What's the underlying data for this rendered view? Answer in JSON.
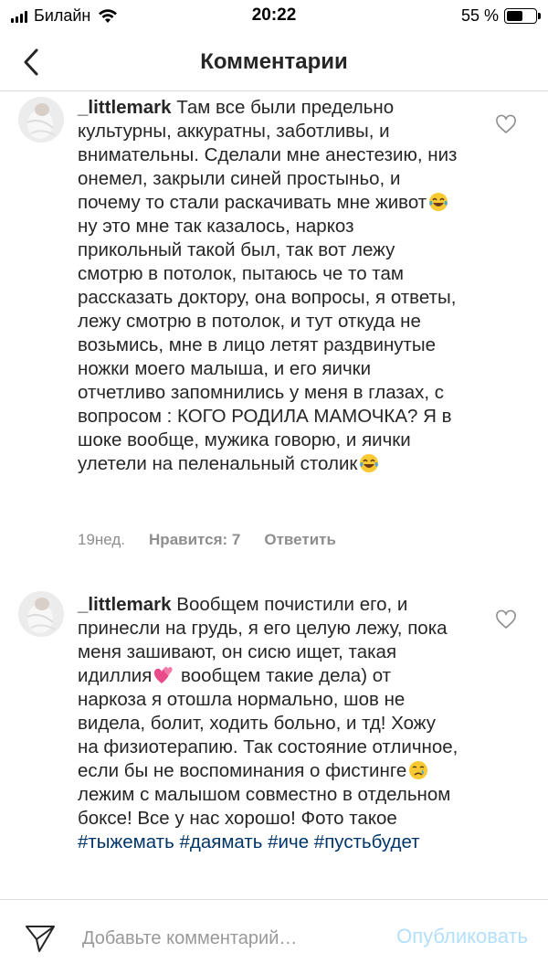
{
  "status_bar": {
    "carrier": "Билайн",
    "time": "20:22",
    "battery": "55 %",
    "battery_level": 0.55
  },
  "nav": {
    "title": "Комментарии"
  },
  "comments": [
    {
      "username": "_littlemark",
      "text_parts": [
        "Там все были предельно культурны, аккуратны, заботливы, и внимательны. Сделали мне анестезию, низ онемел, закрыли синей простыньо, и почему то стали раскачивать мне живот",
        " ну это мне так казалось, наркоз прикольный такой был, так вот лежу смотрю в потолок, пытаюсь че то там рассказать доктору, она вопросы, я ответы, лежу смотрю в потолок, и тут откуда не возьмись, мне в лицо летят раздвинутые ножки моего малыша, и его яички отчетливо запомнились у меня в глазах, с вопросом : КОГО РОДИЛА МАМОЧКА? Я в шоке вообще, мужика говорю, и яички улетели на пеленальный столик"
      ],
      "emojis": [
        "tears-of-joy-emoji",
        "tears-of-joy-emoji"
      ],
      "time": "19нед.",
      "likes": "Нравится: 7",
      "reply": "Ответить"
    },
    {
      "username": "_littlemark",
      "text_parts": [
        "Вообщем почистили его, и принесли на грудь, я его целую лежу, пока меня зашивают, он сисю ищет, такая идиллия",
        " вообщем такие дела) от наркоза я отошла нормально, шов не видела, болит, ходить больно, и тд! Хожу  на физиотерапию. Так состояние отличное, если бы не воспоминания о фистинге",
        "  лежим с малышом совместно в отдельном боксе! Все у нас хорошо!  Фото такое"
      ],
      "emojis": [
        "two-hearts-emoji",
        "crying-face-emoji"
      ],
      "hashtags": [
        "#тыжемать",
        "#даямать",
        "#иче",
        "#пустьбудет"
      ]
    }
  ],
  "footer": {
    "placeholder": "Добавьте комментарий…",
    "publish": "Опубликовать"
  },
  "colors": {
    "text": "#262626",
    "meta": "#8e8e8e",
    "hashtag": "#003569",
    "publish_disabled": "#b2dffc",
    "divider": "#dbdbdb"
  }
}
